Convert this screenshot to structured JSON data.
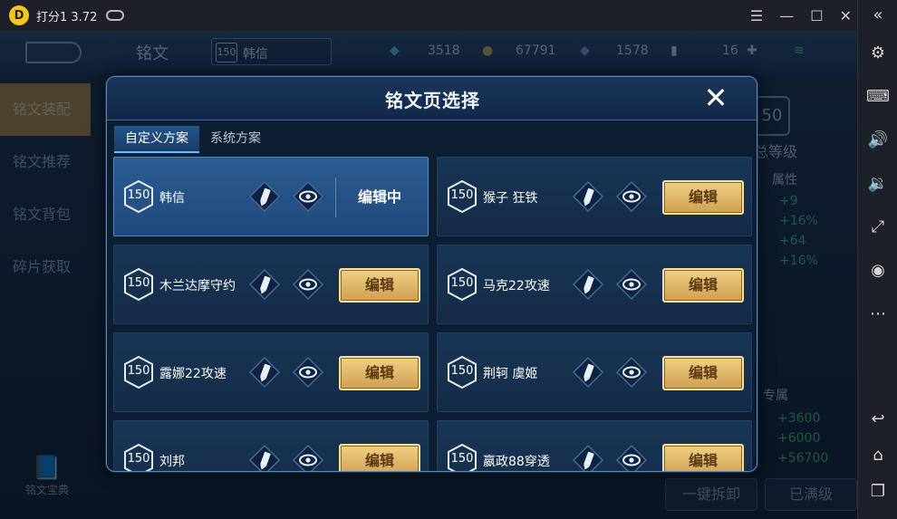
{
  "window": {
    "title": "打分1 3.72"
  },
  "background": {
    "title": "铭文",
    "hero_level": "150",
    "hero_name": "韩信",
    "stats": [
      "3518",
      "67791",
      "1578",
      "16"
    ],
    "menu": [
      "铭文装配",
      "铭文推荐",
      "铭文背包",
      "碎片获取"
    ],
    "dict_label": "铭文宝典",
    "panel_badge": "50",
    "panel_title": "总等级",
    "panel_attr": "属性",
    "panel_values": [
      "+9",
      "+16%",
      "+64",
      "+16%"
    ],
    "panel_exclusive": "专属",
    "panel_values2": [
      "+3600",
      "+6000",
      "+56700"
    ],
    "btn_disassemble": "一键拆卸",
    "btn_full": "已满级"
  },
  "modal": {
    "title": "铭文页选择",
    "close_icon": "close-icon",
    "tabs": [
      "自定义方案",
      "系统方案"
    ],
    "active_tab": 0,
    "editing_label": "编辑中",
    "edit_label": "编辑",
    "pages": [
      {
        "level": "150",
        "name": "韩信",
        "selected": true
      },
      {
        "level": "150",
        "name": "猴子  狂铁",
        "selected": false
      },
      {
        "level": "150",
        "name": "木兰达摩守约",
        "selected": false
      },
      {
        "level": "150",
        "name": "马克22攻速",
        "selected": false
      },
      {
        "level": "150",
        "name": "露娜22攻速",
        "selected": false
      },
      {
        "level": "150",
        "name": "荆轲 虞姬",
        "selected": false
      },
      {
        "level": "150",
        "name": "刘邦",
        "selected": false
      },
      {
        "level": "150",
        "name": "嬴政88穿透",
        "selected": false
      }
    ]
  },
  "colors": {
    "accent_gold": "#cfa052",
    "stat_green": "#3fd079",
    "selected_card": "#2a5d92"
  }
}
